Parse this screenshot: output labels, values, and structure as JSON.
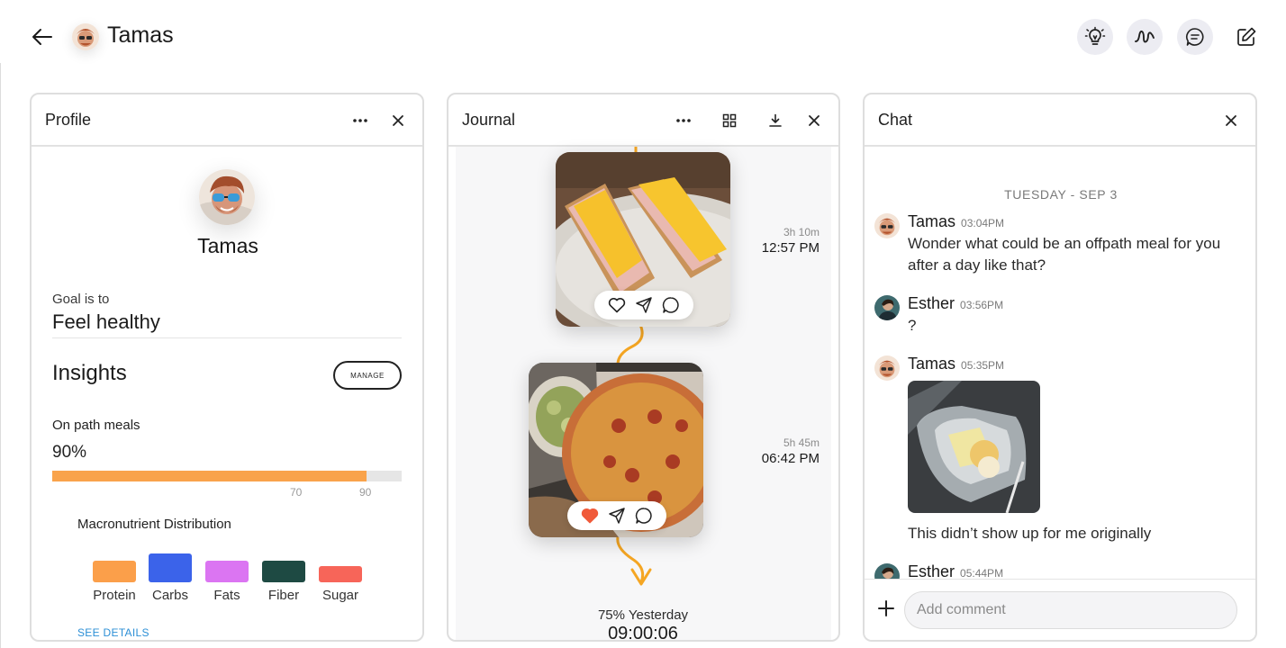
{
  "header": {
    "user_name": "Tamas",
    "icons": [
      "back-arrow-icon",
      "lightbulb-icon",
      "activity-icon",
      "chat-bubble-icon",
      "edit-icon"
    ]
  },
  "profile": {
    "title": "Profile",
    "name": "Tamas",
    "goal_label": "Goal is to",
    "goal_value": "Feel healthy",
    "insights_title": "Insights",
    "manage_label": "MANAGE",
    "on_path_label": "On path meals",
    "on_path_percent": "90%",
    "on_path_value": 0.9,
    "bar_color": "#f9a34b",
    "ticks": [
      "70",
      "90"
    ],
    "macro_title": "Macronutrient Distribution",
    "macros": [
      {
        "label": "Protein",
        "color": "#fb9f4a",
        "level": 0.6
      },
      {
        "label": "Carbs",
        "color": "#3b63ea",
        "level": 0.8
      },
      {
        "label": "Fats",
        "color": "#db75f2",
        "level": 0.6
      },
      {
        "label": "Fiber",
        "color": "#1e4a43",
        "level": 0.6
      },
      {
        "label": "Sugar",
        "color": "#f76559",
        "level": 0.45
      }
    ],
    "see_details": "SEE DETAILS"
  },
  "journal": {
    "title": "Journal",
    "entries": [
      {
        "time_ago": "3h 10m",
        "time": "12:57 PM",
        "liked": false
      },
      {
        "time_ago": "5h 45m",
        "time": "06:42 PM",
        "liked": true
      }
    ],
    "summary_label": "75% Yesterday",
    "summary_time": "09:00:06",
    "accent": "#f5a623"
  },
  "chat": {
    "title": "Chat",
    "day": "TUESDAY - SEP 3",
    "messages": [
      {
        "author": "Tamas",
        "time": "03:04PM",
        "text": "Wonder what could be an offpath meal for you after a day like that?"
      },
      {
        "author": "Esther",
        "time": "03:56PM",
        "text": "?"
      },
      {
        "author": "Tamas",
        "time": "05:35PM",
        "text": "This didn’t show up for me originally"
      },
      {
        "author": "Esther",
        "time": "05:44PM",
        "text": ""
      }
    ],
    "comment_placeholder": "Add comment"
  }
}
